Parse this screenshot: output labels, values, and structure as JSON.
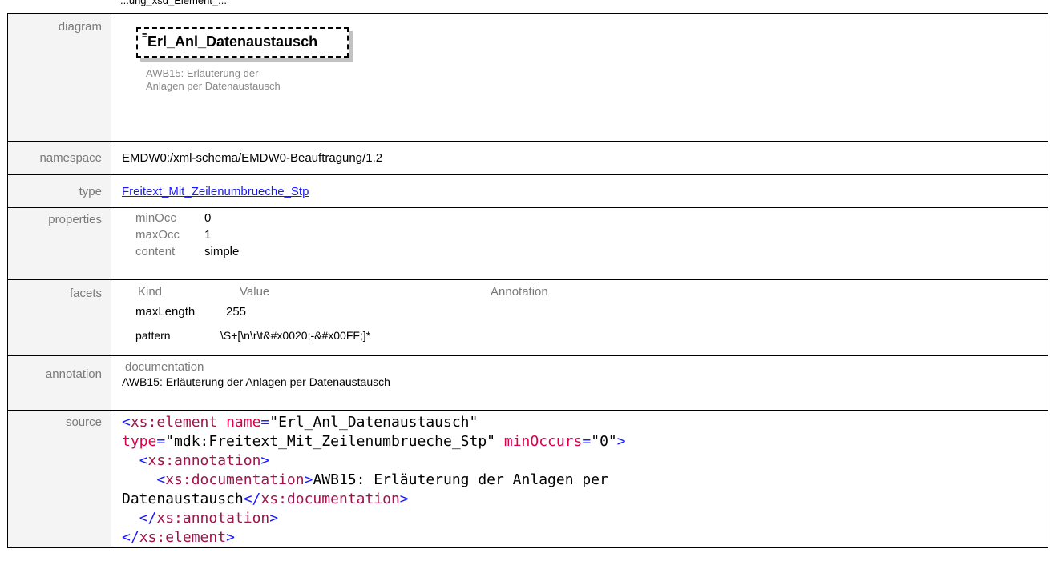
{
  "header_fragment": "...ung_xsd_Element_...",
  "rows": {
    "diagram": {
      "label": "diagram",
      "element_name": "Erl_Anl_Datenaustausch",
      "doc_line1": "AWB15: Erläuterung der",
      "doc_line2": "Anlagen per Datenaustausch"
    },
    "namespace": {
      "label": "namespace",
      "value": "EMDW0:/xml-schema/EMDW0-Beauftragung/1.2"
    },
    "type": {
      "label": "type",
      "value": "Freitext_Mit_Zeilenumbrueche_Stp"
    },
    "properties": {
      "label": "properties",
      "items": [
        {
          "key": "minOcc",
          "value": "0"
        },
        {
          "key": "maxOcc",
          "value": "1"
        },
        {
          "key": "content",
          "value": "simple"
        }
      ]
    },
    "facets": {
      "label": "facets",
      "headers": {
        "kind": "Kind",
        "value": "Value",
        "annotation": "Annotation"
      },
      "rows": [
        {
          "kind": "maxLength",
          "value": "255"
        },
        {
          "kind": "pattern",
          "value": "\\S+[\\n\\r\\t&#x0020;-&#x00FF;]*"
        }
      ]
    },
    "annotation": {
      "label": "annotation",
      "key": "documentation",
      "text": "AWB15: Erläuterung der Anlagen per Datenaustausch"
    },
    "source": {
      "label": "source",
      "tag_element": "xs:element",
      "attr_name": "name",
      "val_name": "\"Erl_Anl_Datenaustausch\"",
      "attr_type": "type",
      "val_type": "\"mdk:Freitext_Mit_Zeilenumbrueche_Stp\"",
      "attr_minoccurs": "minOccurs",
      "val_minoccurs": "\"0\"",
      "tag_annotation": "xs:annotation",
      "tag_documentation": "xs:documentation",
      "doc_text_1": "AWB15: Erläuterung der Anlagen per",
      "doc_text_2": "Datenaustausch"
    }
  }
}
